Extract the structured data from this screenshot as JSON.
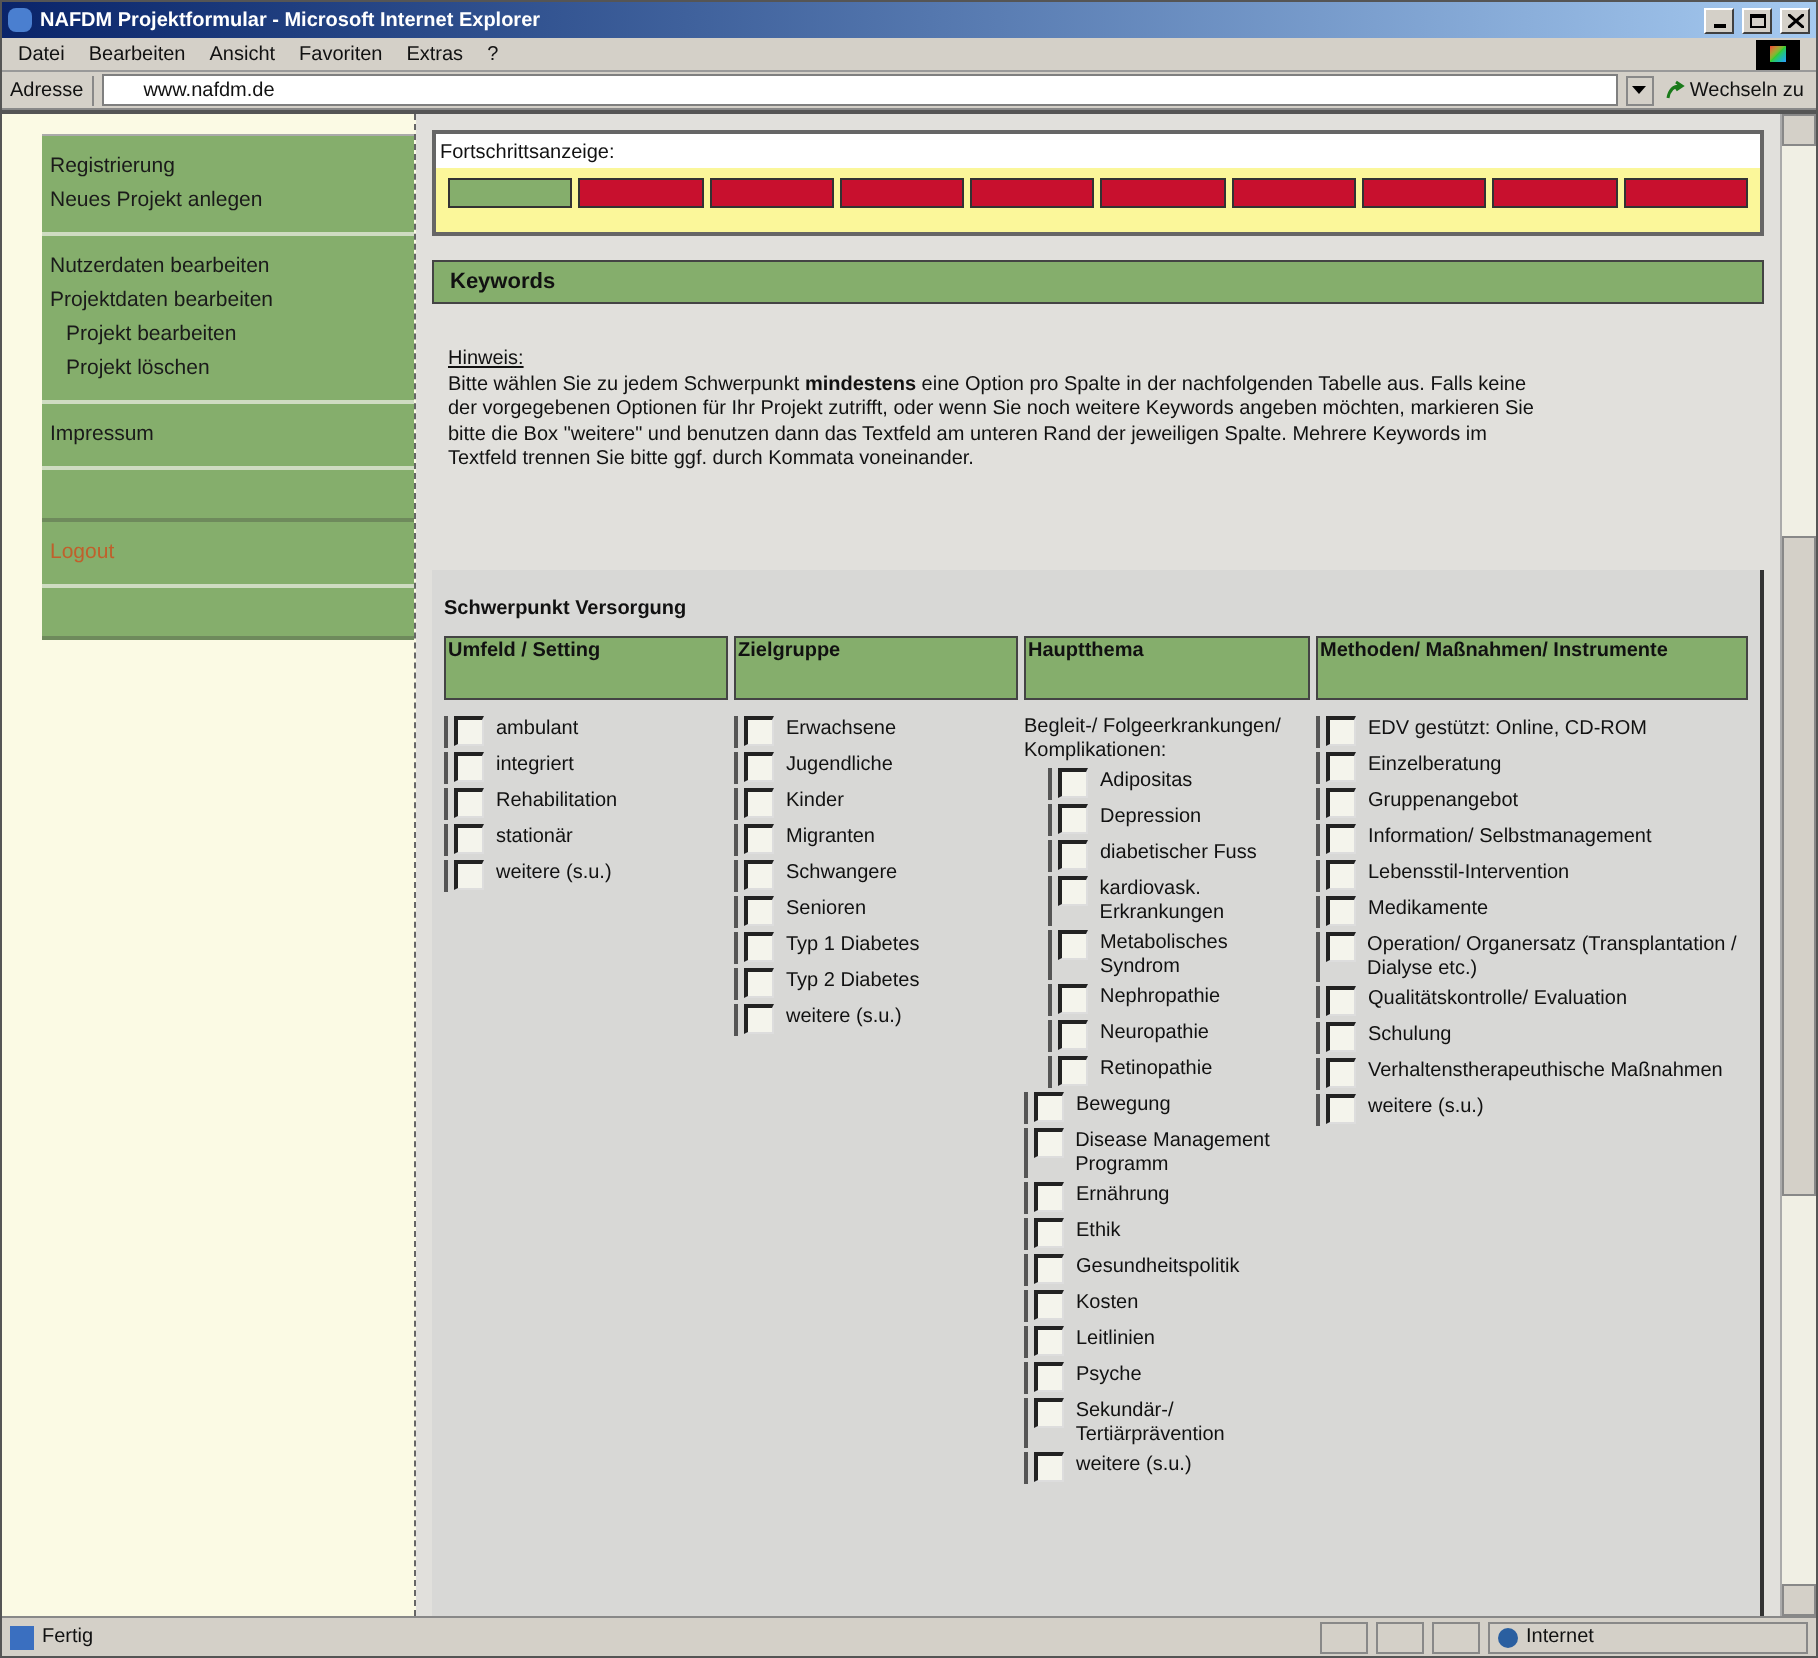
{
  "window": {
    "title": "NAFDM Projektformular - Microsoft Internet Explorer"
  },
  "menu": [
    "Datei",
    "Bearbeiten",
    "Ansicht",
    "Favoriten",
    "Extras",
    "?"
  ],
  "address_bar": {
    "label": "Adresse",
    "value": "www.nafdm.de",
    "go": "Wechseln zu"
  },
  "sidebar": {
    "sections": [
      {
        "items": [
          {
            "label": "Registrierung",
            "kind": "link"
          },
          {
            "label": "Neues Projekt anlegen",
            "kind": "link"
          }
        ]
      },
      {
        "items": [
          {
            "label": "Nutzerdaten bearbeiten",
            "kind": "link"
          },
          {
            "label": "Projektdaten bearbeiten",
            "kind": "link",
            "children": [
              {
                "label": "Projekt bearbeiten"
              },
              {
                "label": "Projekt löschen"
              }
            ]
          }
        ]
      },
      {
        "items": [
          {
            "label": "Impressum",
            "kind": "link"
          }
        ]
      },
      {
        "items": [
          {
            "label": "Logout",
            "kind": "logout"
          }
        ]
      }
    ]
  },
  "progress": {
    "label": "Fortschrittsanzeige:",
    "segments": [
      {
        "done": true
      },
      {
        "done": false
      },
      {
        "done": false
      },
      {
        "done": false
      },
      {
        "done": false
      },
      {
        "done": false
      },
      {
        "done": false
      },
      {
        "done": false
      },
      {
        "done": false
      },
      {
        "done": false
      }
    ]
  },
  "section_title": "Keywords",
  "hint": {
    "title": "Hinweis:",
    "text": "Bitte wählen Sie zu jedem Schwerpunkt **mindestens** eine Option pro Spalte in der nachfolgenden Tabelle aus. Falls keine der vorgegebenen Optionen für Ihr Projekt zutrifft, oder wenn Sie noch weitere Keywords angeben möchten, markieren Sie bitte die Box \"weitere\" und benutzen dann das Textfeld am unteren Rand der jeweiligen Spalte. Mehrere Keywords im Textfeld trennen Sie bitte ggf. durch Kommata voneinander."
  },
  "table": {
    "title": "Schwerpunkt Versorgung",
    "columns": [
      {
        "heading": "Umfeld / Setting",
        "options": [
          {
            "label": "ambulant",
            "checked": false
          },
          {
            "label": "integriert",
            "checked": false
          },
          {
            "label": "Rehabilitation",
            "checked": false
          },
          {
            "label": "stationär",
            "checked": false
          },
          {
            "label": "weitere (s.u.)",
            "checked": false
          }
        ]
      },
      {
        "heading": "Zielgruppe",
        "options": [
          {
            "label": "Erwachsene",
            "checked": false
          },
          {
            "label": "Jugendliche",
            "checked": false
          },
          {
            "label": "Kinder",
            "checked": false
          },
          {
            "label": "Migranten",
            "checked": false
          },
          {
            "label": "Schwangere",
            "checked": false
          },
          {
            "label": "Senioren",
            "checked": false
          },
          {
            "label": "Typ 1 Diabetes",
            "checked": false
          },
          {
            "label": "Typ 2 Diabetes",
            "checked": false
          },
          {
            "label": "weitere (s.u.)",
            "checked": false
          }
        ]
      },
      {
        "heading": "Hauptthema",
        "options": [
          {
            "label": "Begleit-/ Folgeerkrankungen/ Komplikationen:",
            "kind": "group",
            "children": [
              {
                "label": "Adipositas",
                "checked": false
              },
              {
                "label": "Depression",
                "checked": false
              },
              {
                "label": "diabetischer Fuss",
                "checked": false
              },
              {
                "label": "kardiovask. Erkrankungen",
                "checked": false
              },
              {
                "label": "Metabolisches Syndrom",
                "checked": false
              },
              {
                "label": "Nephropathie",
                "checked": false
              },
              {
                "label": "Neuropathie",
                "checked": false
              },
              {
                "label": "Retinopathie",
                "checked": false
              }
            ]
          },
          {
            "label": "Bewegung",
            "checked": false
          },
          {
            "label": "Disease Management Programm",
            "checked": false
          },
          {
            "label": "Ernährung",
            "checked": false
          },
          {
            "label": "Ethik",
            "checked": false
          },
          {
            "label": "Gesundheitspolitik",
            "checked": false
          },
          {
            "label": "Kosten",
            "checked": false
          },
          {
            "label": "Leitlinien",
            "checked": false
          },
          {
            "label": "Psyche",
            "checked": false
          },
          {
            "label": "Sekundär-/ Tertiärprävention",
            "checked": false
          },
          {
            "label": "weitere (s.u.)",
            "checked": false
          }
        ]
      },
      {
        "heading": "Methoden/ Maßnahmen/ Instrumente",
        "options": [
          {
            "label": "EDV gestützt: Online, CD-ROM",
            "checked": false
          },
          {
            "label": "Einzelberatung",
            "checked": false
          },
          {
            "label": "Gruppenangebot",
            "checked": false
          },
          {
            "label": "Information/ Selbstmanagement",
            "checked": false
          },
          {
            "label": "Lebensstil-Intervention",
            "checked": false
          },
          {
            "label": "Medikamente",
            "checked": false
          },
          {
            "label": "Operation/ Organersatz (Transplantation / Dialyse etc.)",
            "checked": false
          },
          {
            "label": "Qualitätskontrolle/ Evaluation",
            "checked": false
          },
          {
            "label": "Schulung",
            "checked": false
          },
          {
            "label": "Verhaltenstherapeuthische Maßnahmen",
            "checked": false
          },
          {
            "label": "weitere (s.u.)",
            "checked": false
          }
        ]
      }
    ]
  },
  "status_bar": {
    "text": "Fertig",
    "zone": "Internet"
  }
}
